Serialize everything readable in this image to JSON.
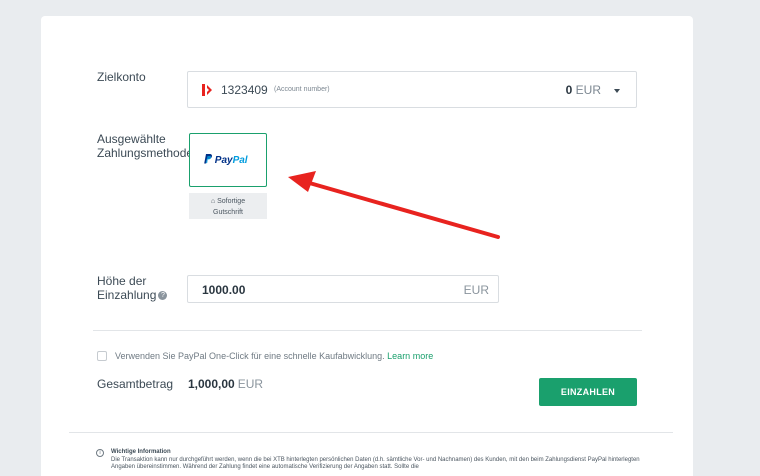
{
  "target_account": {
    "label": "Zielkonto",
    "account_id": "1323409",
    "account_hint": "(Account number)",
    "balance_value": "0",
    "balance_currency": "EUR"
  },
  "payment_method": {
    "label_line1": "Ausgewählte",
    "label_line2": "Zahlungsmethode",
    "selected": {
      "name_pay": "Pay",
      "name_pal": "Pal",
      "badge_line1": "Sofortige",
      "badge_line2": "Gutschrift"
    }
  },
  "deposit": {
    "label_line1": "Höhe der",
    "label_line2": "Einzahlung",
    "amount": "1000.00",
    "currency": "EUR"
  },
  "oneclick": {
    "text": "Verwenden Sie PayPal One-Click für eine schnelle Kaufabwicklung.",
    "link": "Learn more"
  },
  "summary": {
    "label": "Gesamtbetrag",
    "value": "1,000,00",
    "currency": "EUR"
  },
  "actions": {
    "submit": "EINZAHLEN"
  },
  "info": {
    "title": "Wichtige Information",
    "text": "Die Transaktion kann nur durchgeführt werden, wenn die bei XTB hinterlegten persönlichen Daten (d.h. sämtliche Vor- und Nachnamen) des Kunden, mit den beim Zahlungsdienst PayPal hinterlegten Angaben übereinstimmen. Während der Zahlung findet eine automatische Verifizierung der Angaben statt. Sollte die"
  },
  "colors": {
    "accent": "#1aa06d",
    "annotation_arrow": "#e8231f",
    "paypal_dark": "#003087",
    "paypal_light": "#009cde"
  }
}
